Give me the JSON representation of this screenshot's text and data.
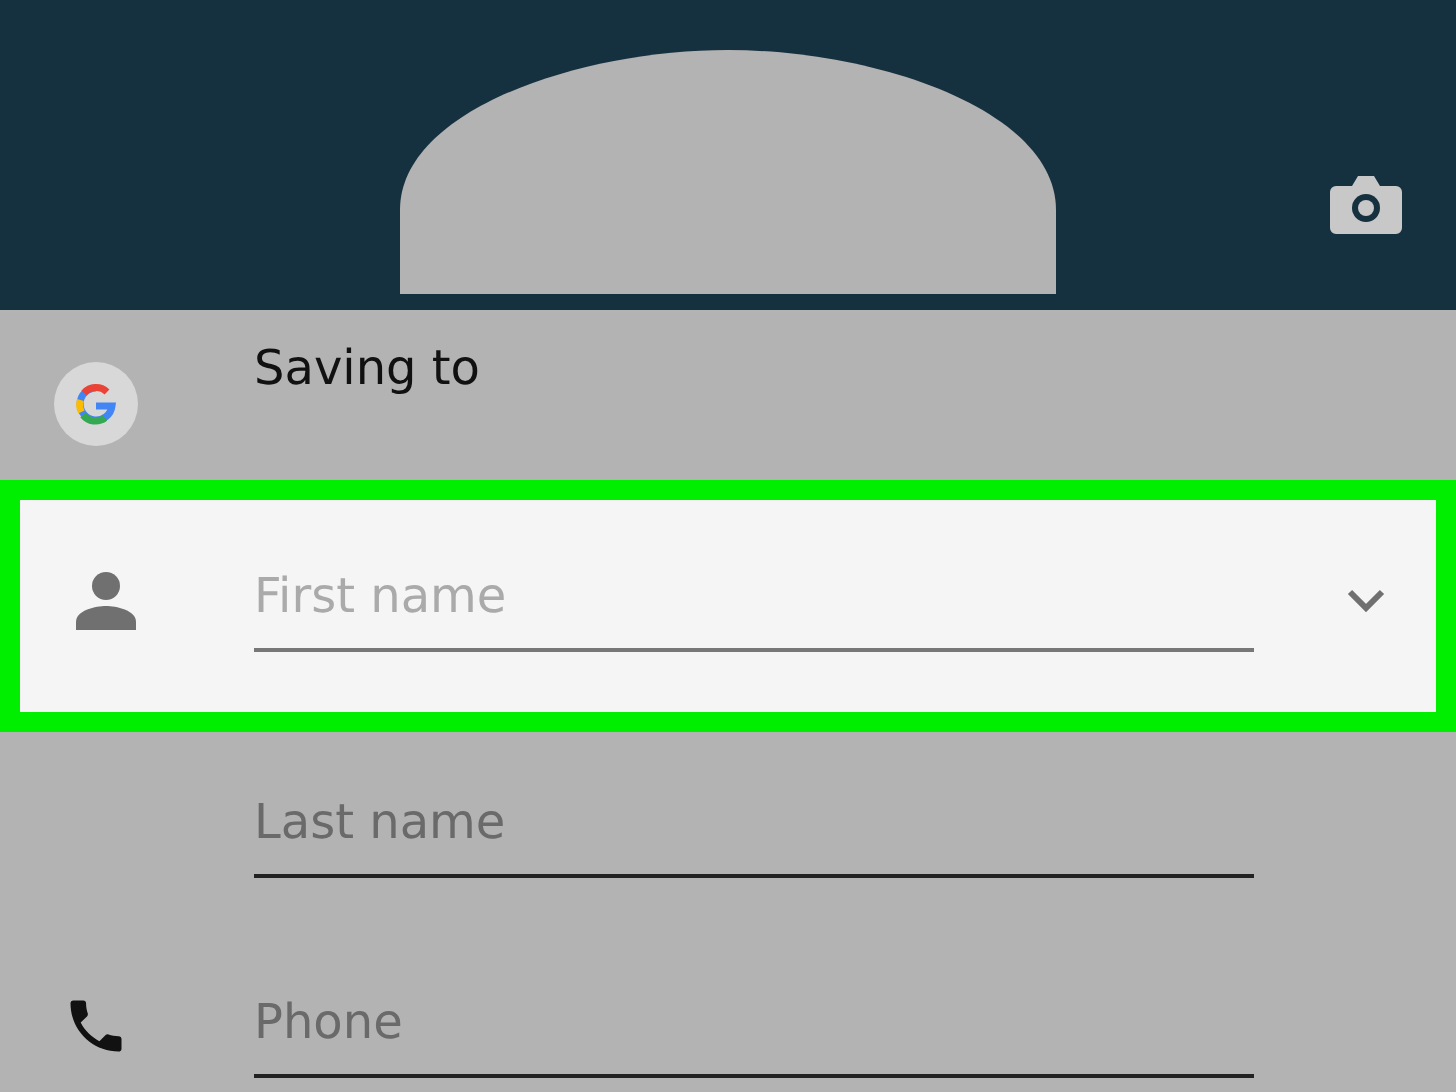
{
  "header": {
    "camera_button": true
  },
  "account": {
    "label": "Saving to"
  },
  "fields": [
    {
      "placeholder": "First name",
      "kind": "person",
      "highlighted": true,
      "expandable": true
    },
    {
      "placeholder": "Last name",
      "kind": "plain",
      "highlighted": false,
      "expandable": false
    },
    {
      "placeholder": "Phone",
      "kind": "phone",
      "highlighted": false,
      "expandable": false
    }
  ]
}
